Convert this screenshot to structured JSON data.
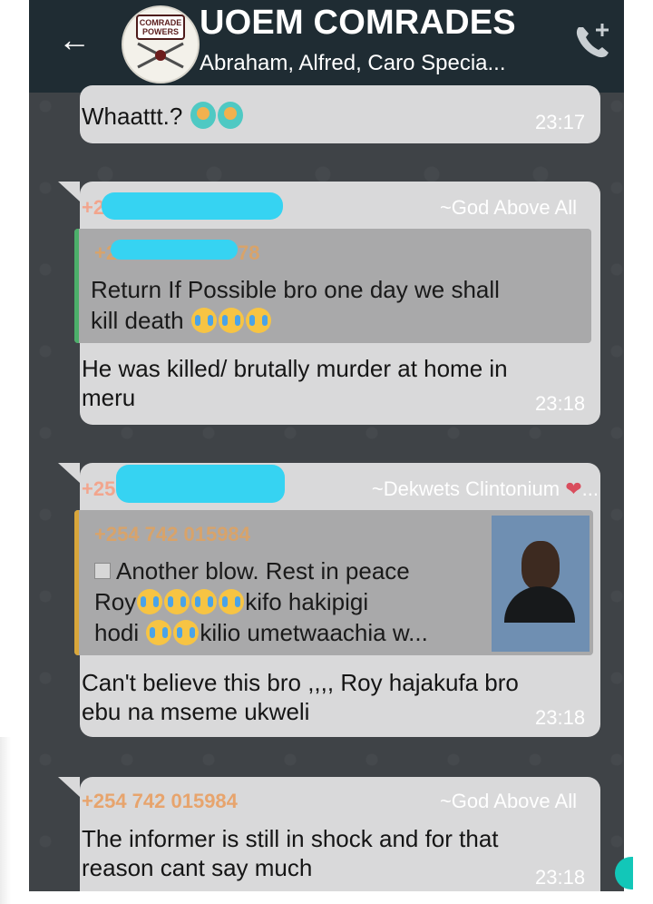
{
  "header": {
    "title": "UOEM COMRADES",
    "members": "Abraham, Alfred, Caro Specia...",
    "avatar_badge": "COMRADE POWERS"
  },
  "messages": [
    {
      "text": "Whaattt.?",
      "time": "23:17"
    },
    {
      "sender_number": "+2",
      "sender_name": "~God Above All",
      "quote_number": "+2",
      "quote_number_suffix": "78",
      "quote_text_1": "Return If Possible bro one day we shall",
      "quote_text_2": "kill death",
      "text_1": "He was killed/ brutally murder at home in",
      "text_2": "meru",
      "time": "23:18"
    },
    {
      "sender_number": "+25",
      "sender_name": "~Dekwets Clintonium",
      "sender_name_suffix": "...",
      "quote_number": "+254 742 015984",
      "quote_line_1": "Another blow. Rest in peace",
      "quote_line_2a": "Roy",
      "quote_line_2b": "kifo hakipigi",
      "quote_line_3a": "hodi",
      "quote_line_3b": "kilio umetwaachia w...",
      "text_1": "Can't believe this bro ,,,, Roy hajakufa bro",
      "text_2": "ebu na mseme ukweli",
      "time": "23:18"
    },
    {
      "sender_number": "+254 742 015984",
      "sender_name": "~God Above All",
      "text_1": "The informer is still in shock and for that",
      "text_2": "reason cant say much",
      "time": "23:18"
    }
  ],
  "colors": {
    "header_bg": "#1f2c33",
    "chat_bg": "#3f4347",
    "bubble": "#d9d9da",
    "quote_bar_1": "#4caf6a",
    "quote_bar_2": "#d9a63a",
    "redaction": "#36d3f2"
  },
  "icons": {
    "back": "back-arrow-icon",
    "call": "add-call-icon"
  }
}
